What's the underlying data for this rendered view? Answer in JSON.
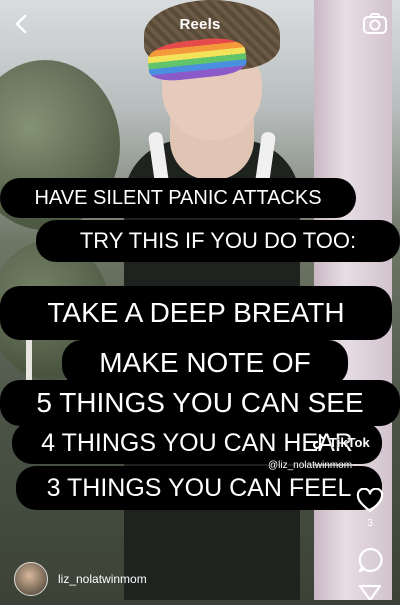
{
  "header": {
    "title": "Reels"
  },
  "captions": [
    "HAVE SILENT PANIC ATTACKS",
    "TRY THIS IF YOU DO TOO:",
    "TAKE A DEEP BREATH",
    "MAKE NOTE OF",
    "5 THINGS YOU CAN SEE",
    "4 THINGS YOU CAN HEAR",
    "3 THINGS YOU CAN FEEL"
  ],
  "watermark": {
    "brand": "TikTok",
    "handle": "@liz_nolatwinmom"
  },
  "actions": {
    "like_count": "3"
  },
  "author": {
    "username": "liz_nolatwinmom"
  },
  "icons": {
    "back": "chevron-left-icon",
    "camera": "camera-icon",
    "like": "heart-icon",
    "comment": "comment-icon",
    "share": "send-icon"
  }
}
